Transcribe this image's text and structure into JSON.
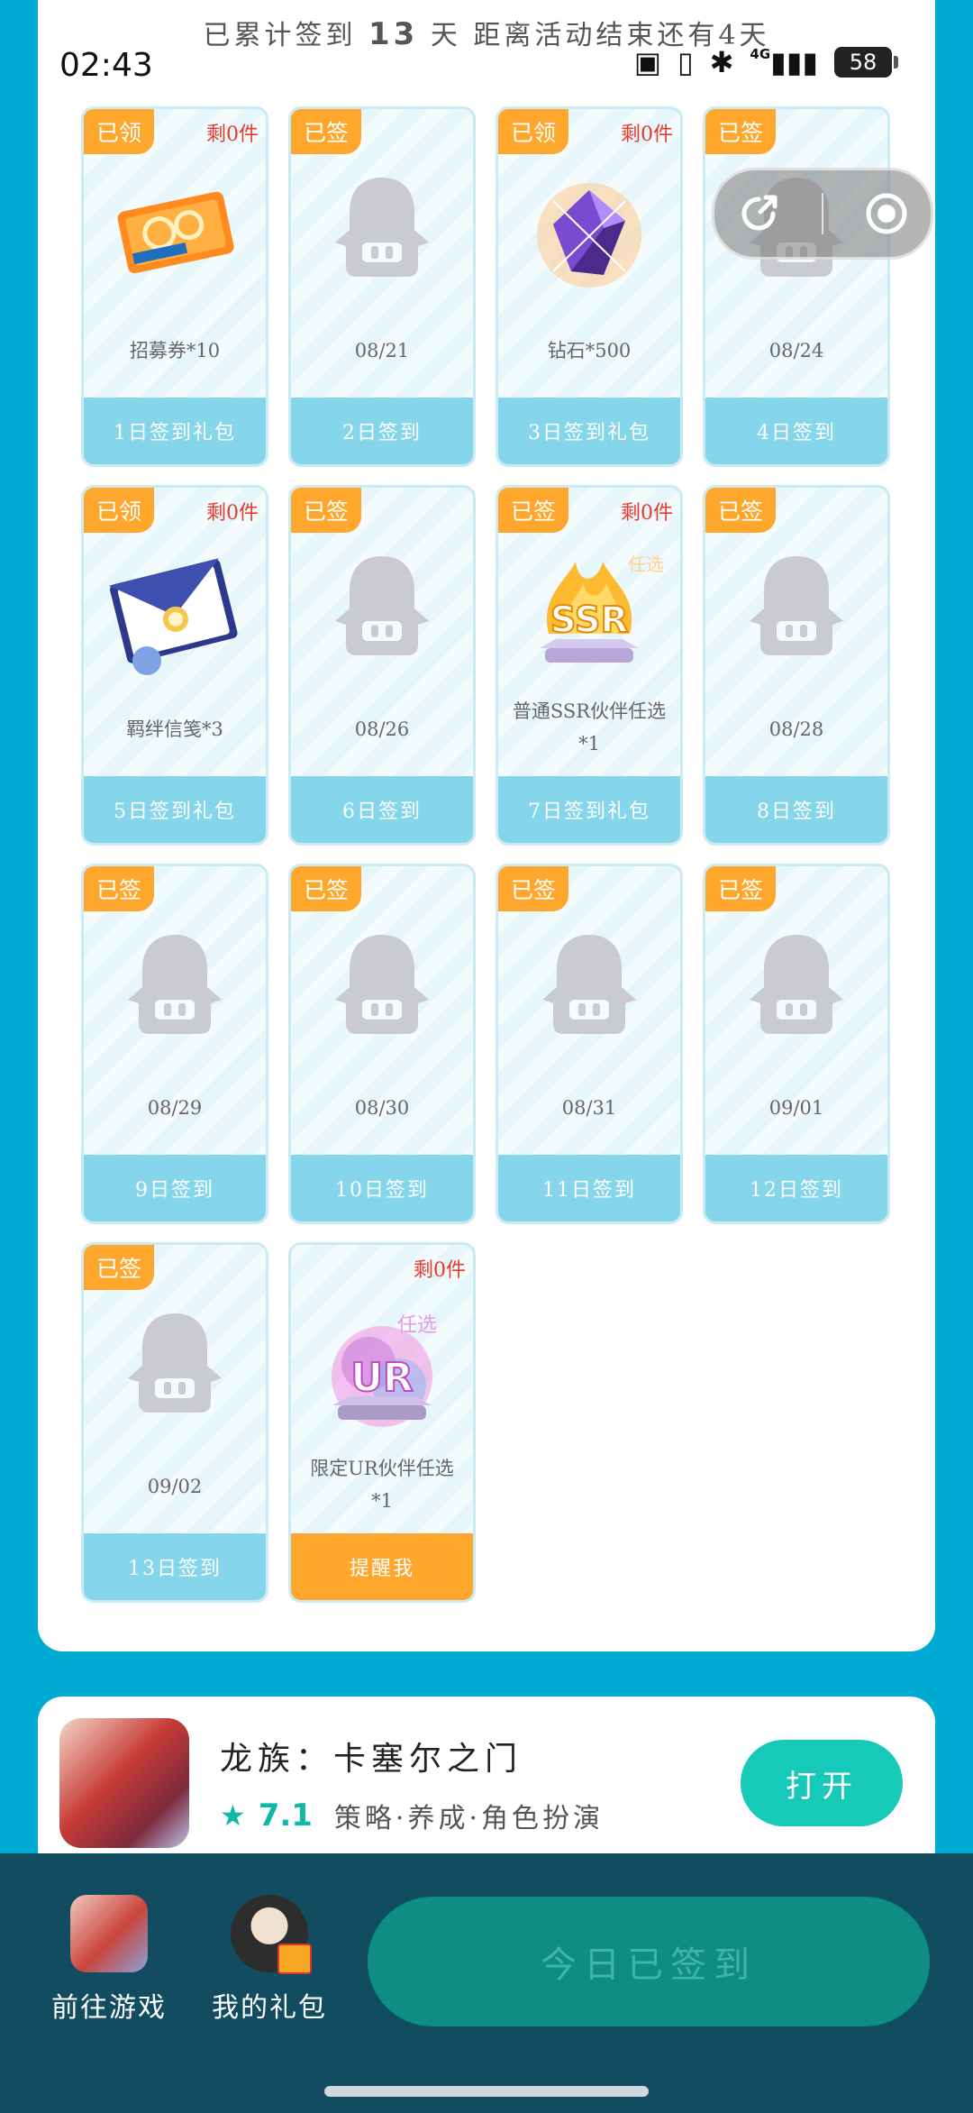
{
  "status": {
    "time": "02:43",
    "network": "4G",
    "battery": "58"
  },
  "summary": {
    "prefix": "已累计签到",
    "days": "13",
    "middle": "天  距离活动结束还有",
    "remaining": "4",
    "suffix": "天"
  },
  "cards": [
    {
      "tag": "已领",
      "remain": "剩0件",
      "art": "ticket",
      "caption": "招募券*10",
      "footer": "1日签到礼包"
    },
    {
      "tag": "已签",
      "remain": "",
      "art": "avatar",
      "caption": "08/21",
      "footer": "2日签到"
    },
    {
      "tag": "已领",
      "remain": "剩0件",
      "art": "diamond",
      "caption": "钻石*500",
      "footer": "3日签到礼包"
    },
    {
      "tag": "已签",
      "remain": "",
      "art": "avatar",
      "caption": "08/24",
      "footer": "4日签到"
    },
    {
      "tag": "已领",
      "remain": "剩0件",
      "art": "letter",
      "caption": "羁绊信笺*3",
      "footer": "5日签到礼包"
    },
    {
      "tag": "已签",
      "remain": "",
      "art": "avatar",
      "caption": "08/26",
      "footer": "6日签到"
    },
    {
      "tag": "已签",
      "remain": "剩0件",
      "art": "ssr",
      "caption": "普通SSR伙伴任选\n*1",
      "footer": "7日签到礼包"
    },
    {
      "tag": "已签",
      "remain": "",
      "art": "avatar",
      "caption": "08/28",
      "footer": "8日签到"
    },
    {
      "tag": "已签",
      "remain": "",
      "art": "avatar",
      "caption": "08/29",
      "footer": "9日签到"
    },
    {
      "tag": "已签",
      "remain": "",
      "art": "avatar",
      "caption": "08/30",
      "footer": "10日签到"
    },
    {
      "tag": "已签",
      "remain": "",
      "art": "avatar",
      "caption": "08/31",
      "footer": "11日签到"
    },
    {
      "tag": "已签",
      "remain": "",
      "art": "avatar",
      "caption": "09/01",
      "footer": "12日签到"
    },
    {
      "tag": "已签",
      "remain": "",
      "art": "avatar",
      "caption": "09/02",
      "footer": "13日签到"
    },
    {
      "tag": "",
      "remain": "剩0件",
      "art": "ur",
      "caption": "限定UR伙伴任选\n*1",
      "footer": "提醒我",
      "footer_style": "remind"
    }
  ],
  "ssr_badge": "任选",
  "ssr_text": "SSR",
  "ur_badge": "任选",
  "ur_text": "UR",
  "game": {
    "name": "龙族：卡塞尔之门",
    "rating": "7.1",
    "genre": "策略·养成·角色扮演",
    "open_label": "打开"
  },
  "bottom": {
    "go_game_label": "前往游戏",
    "my_gifts_label": "我的礼包",
    "signed_label": "今日已签到"
  },
  "colors": {
    "accent_orange": "#ffa72c",
    "accent_teal": "#16c9b8",
    "card_footer": "#85d6ea"
  }
}
